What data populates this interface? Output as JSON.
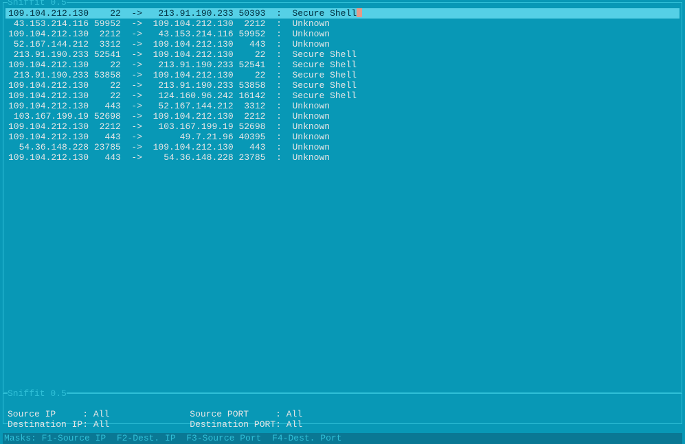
{
  "app": {
    "title": "Sniffit 0.5"
  },
  "colors": {
    "bg": "#0898b6",
    "border": "#30c0d8",
    "text": "#e6e6e6",
    "selected_bg": "#55d0e6",
    "selected_fg": "#003040",
    "footer_bg": "#0a7894"
  },
  "connections": [
    {
      "src_ip": "109.104.212.130",
      "src_port": "22",
      "dst_ip": "213.91.190.233",
      "dst_port": "50393",
      "proto": "Secure Shell",
      "selected": true
    },
    {
      "src_ip": "43.153.214.116",
      "src_port": "59952",
      "dst_ip": "109.104.212.130",
      "dst_port": "2212",
      "proto": "Unknown",
      "selected": false
    },
    {
      "src_ip": "109.104.212.130",
      "src_port": "2212",
      "dst_ip": "43.153.214.116",
      "dst_port": "59952",
      "proto": "Unknown",
      "selected": false
    },
    {
      "src_ip": "52.167.144.212",
      "src_port": "3312",
      "dst_ip": "109.104.212.130",
      "dst_port": "443",
      "proto": "Unknown",
      "selected": false
    },
    {
      "src_ip": "213.91.190.233",
      "src_port": "52541",
      "dst_ip": "109.104.212.130",
      "dst_port": "22",
      "proto": "Secure Shell",
      "selected": false
    },
    {
      "src_ip": "109.104.212.130",
      "src_port": "22",
      "dst_ip": "213.91.190.233",
      "dst_port": "52541",
      "proto": "Secure Shell",
      "selected": false
    },
    {
      "src_ip": "213.91.190.233",
      "src_port": "53858",
      "dst_ip": "109.104.212.130",
      "dst_port": "22",
      "proto": "Secure Shell",
      "selected": false
    },
    {
      "src_ip": "109.104.212.130",
      "src_port": "22",
      "dst_ip": "213.91.190.233",
      "dst_port": "53858",
      "proto": "Secure Shell",
      "selected": false
    },
    {
      "src_ip": "109.104.212.130",
      "src_port": "22",
      "dst_ip": "124.160.96.242",
      "dst_port": "16142",
      "proto": "Secure Shell",
      "selected": false
    },
    {
      "src_ip": "109.104.212.130",
      "src_port": "443",
      "dst_ip": "52.167.144.212",
      "dst_port": "3312",
      "proto": "Unknown",
      "selected": false
    },
    {
      "src_ip": "103.167.199.19",
      "src_port": "52698",
      "dst_ip": "109.104.212.130",
      "dst_port": "2212",
      "proto": "Unknown",
      "selected": false
    },
    {
      "src_ip": "109.104.212.130",
      "src_port": "2212",
      "dst_ip": "103.167.199.19",
      "dst_port": "52698",
      "proto": "Unknown",
      "selected": false
    },
    {
      "src_ip": "109.104.212.130",
      "src_port": "443",
      "dst_ip": "49.7.21.96",
      "dst_port": "40395",
      "proto": "Unknown",
      "selected": false
    },
    {
      "src_ip": "54.36.148.228",
      "src_port": "23785",
      "dst_ip": "109.104.212.130",
      "dst_port": "443",
      "proto": "Unknown",
      "selected": false
    },
    {
      "src_ip": "109.104.212.130",
      "src_port": "443",
      "dst_ip": "54.36.148.228",
      "dst_port": "23785",
      "proto": "Unknown",
      "selected": false
    }
  ],
  "arrow": "->",
  "sep": ":",
  "filters_panel": {
    "title": "Sniffit 0.5",
    "source_ip_label": "Source IP     :",
    "source_ip_value": "All",
    "source_port_label": "Source PORT     :",
    "source_port_value": "All",
    "dest_ip_label": "Destination IP:",
    "dest_ip_value": "All",
    "dest_port_label": "Destination PORT:",
    "dest_port_value": "All"
  },
  "footer": {
    "text": "Masks: F1-Source IP  F2-Dest. IP  F3-Source Port  F4-Dest. Port"
  }
}
